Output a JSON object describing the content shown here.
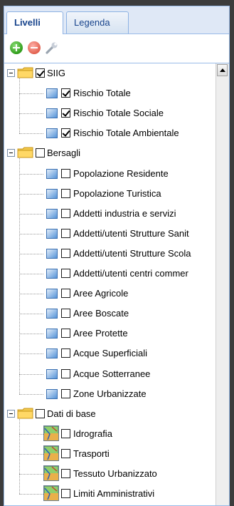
{
  "tabs": [
    {
      "label": "Livelli",
      "active": true
    },
    {
      "label": "Legenda",
      "active": false
    }
  ],
  "toolbar": {
    "buttons": [
      "add-icon",
      "remove-icon",
      "wrench-icon"
    ]
  },
  "tree": {
    "groups": [
      {
        "label": "SIIG",
        "checked": true,
        "icon": "folder-icon",
        "layers": [
          {
            "label": "Rischio Totale",
            "checked": true,
            "icon": "vector-layer-icon"
          },
          {
            "label": "Rischio Totale Sociale",
            "checked": true,
            "icon": "vector-layer-icon"
          },
          {
            "label": "Rischio Totale Ambientale",
            "checked": true,
            "icon": "vector-layer-icon"
          }
        ]
      },
      {
        "label": "Bersagli",
        "checked": false,
        "icon": "folder-icon",
        "layers": [
          {
            "label": "Popolazione Residente",
            "checked": false,
            "icon": "vector-layer-icon"
          },
          {
            "label": "Popolazione Turistica",
            "checked": false,
            "icon": "vector-layer-icon"
          },
          {
            "label": "Addetti industria e servizi",
            "checked": false,
            "icon": "vector-layer-icon"
          },
          {
            "label": "Addetti/utenti Strutture Sanit",
            "checked": false,
            "icon": "vector-layer-icon"
          },
          {
            "label": "Addetti/utenti Strutture Scola",
            "checked": false,
            "icon": "vector-layer-icon"
          },
          {
            "label": "Addetti/utenti centri commer",
            "checked": false,
            "icon": "vector-layer-icon"
          },
          {
            "label": "Aree Agricole",
            "checked": false,
            "icon": "vector-layer-icon"
          },
          {
            "label": "Aree Boscate",
            "checked": false,
            "icon": "vector-layer-icon"
          },
          {
            "label": "Aree Protette",
            "checked": false,
            "icon": "vector-layer-icon"
          },
          {
            "label": "Acque Superficiali",
            "checked": false,
            "icon": "vector-layer-icon"
          },
          {
            "label": "Acque Sotterranee",
            "checked": false,
            "icon": "vector-layer-icon"
          },
          {
            "label": "Zone Urbanizzate",
            "checked": false,
            "icon": "vector-layer-icon"
          }
        ]
      },
      {
        "label": "Dati di base",
        "checked": false,
        "icon": "folder-icon",
        "layers": [
          {
            "label": "Idrografia",
            "checked": false,
            "icon": "raster-layer-icon"
          },
          {
            "label": "Trasporti",
            "checked": false,
            "icon": "raster-layer-icon"
          },
          {
            "label": "Tessuto Urbanizzato",
            "checked": false,
            "icon": "raster-layer-icon"
          },
          {
            "label": "Limiti Amministrativi",
            "checked": false,
            "icon": "raster-layer-icon"
          }
        ]
      }
    ]
  }
}
